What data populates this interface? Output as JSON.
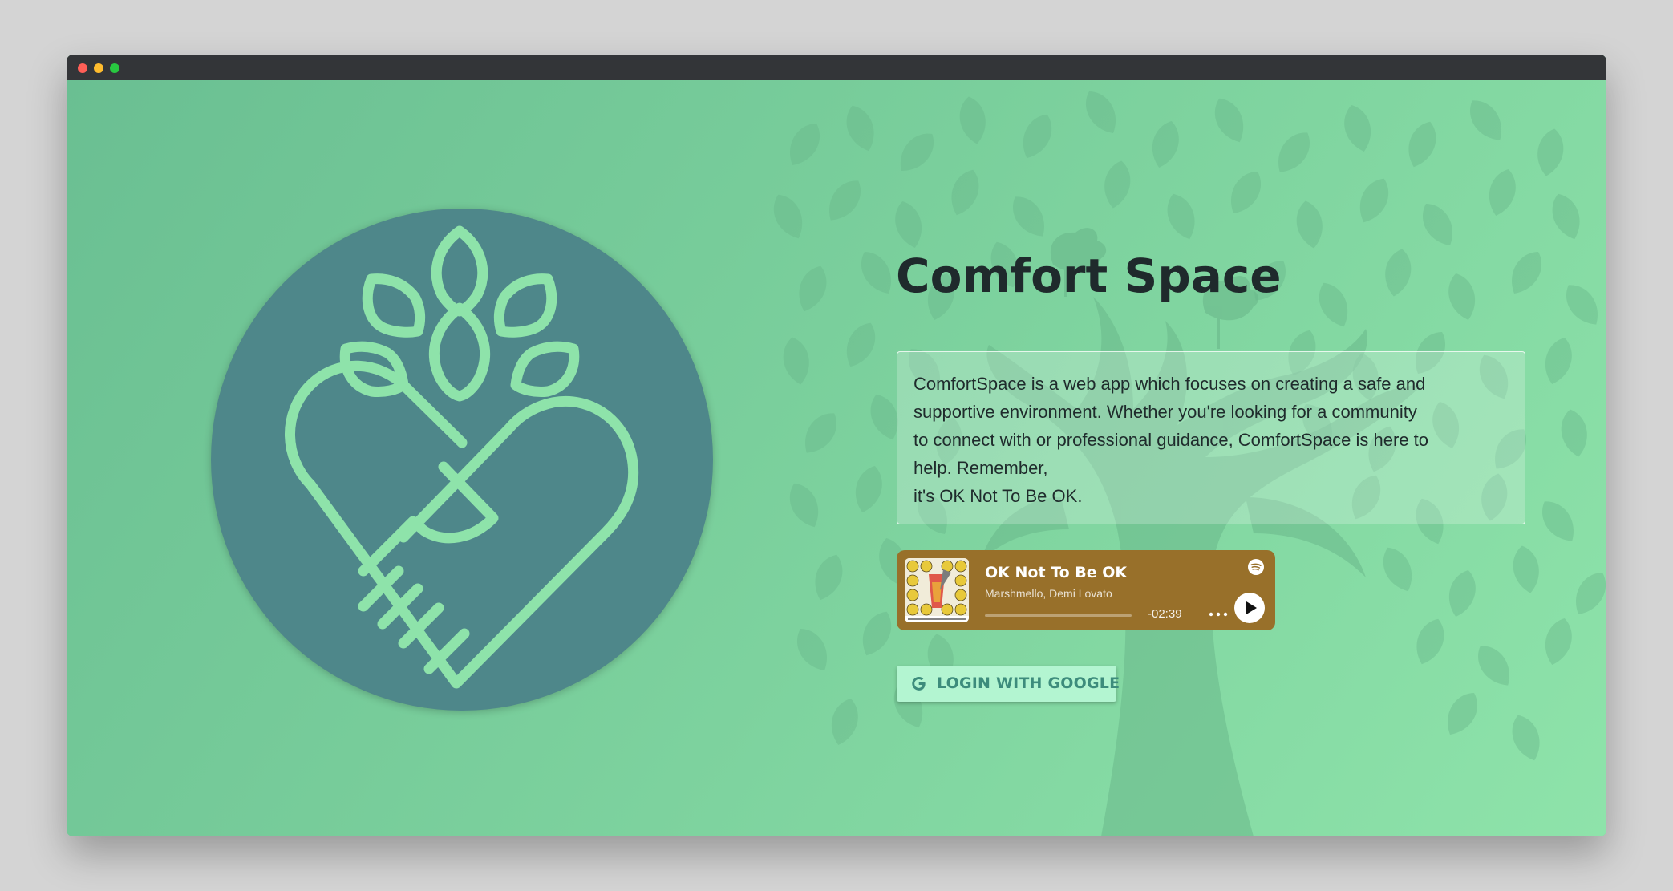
{
  "page": {
    "title": "Comfort Space",
    "description_lines": [
      "ComfortSpace is a web app which focuses on creating a safe and",
      "supportive environment. Whether you're looking for a community",
      "to connect with or professional guidance, ComfortSpace is here to",
      "help. Remember,",
      "it's OK Not To Be OK."
    ]
  },
  "player": {
    "track_title": "OK Not To Be OK",
    "artist": "Marshmello, Demi Lovato",
    "time_remaining": "-02:39",
    "progress": 0.0
  },
  "login": {
    "label": "LOGIN WITH GOOGLE"
  },
  "colors": {
    "background": "#77c998",
    "logo_circle": "#4e878a",
    "logo_stroke": "#8ee3aa",
    "player_bg": "#98702a",
    "button_bg": "#b3f5d1",
    "button_text": "#3d8c7c",
    "title_text": "#1f2a2c"
  },
  "icons": {
    "logo": "heart-handshake-leaves-logo",
    "spotify": "spotify-icon",
    "more": "more-dots-icon",
    "play": "play-icon",
    "google": "google-g-icon"
  }
}
